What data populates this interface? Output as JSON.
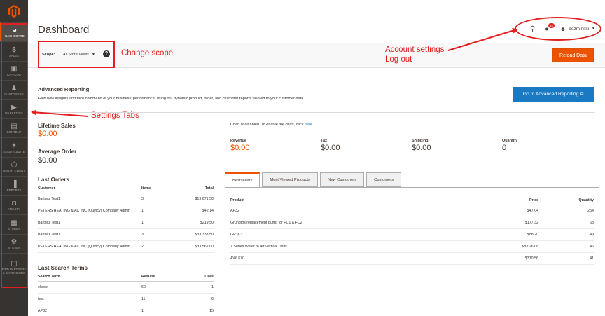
{
  "sidebar": {
    "items": [
      {
        "label": "DASHBOARD",
        "icon": "◕",
        "active": true
      },
      {
        "label": "SALES",
        "icon": "$"
      },
      {
        "label": "CATALOG",
        "icon": "▣"
      },
      {
        "label": "CUSTOMERS",
        "icon": "♟"
      },
      {
        "label": "MARKETING",
        "icon": "▶"
      },
      {
        "label": "CONTENT",
        "icon": "▤"
      },
      {
        "label": "ELASTICSUITE",
        "icon": "✶"
      },
      {
        "label": "OAUTH CLIENT",
        "icon": "⬡"
      },
      {
        "label": "REPORTS",
        "icon": "▐"
      },
      {
        "label": "AMASTY",
        "icon": "◘"
      },
      {
        "label": "STORES",
        "icon": "▦"
      },
      {
        "label": "SYSTEM",
        "icon": "⚙"
      },
      {
        "label": "FIND PARTNERS & EXTENSIONS",
        "icon": "▢"
      }
    ]
  },
  "header": {
    "title": "Dashboard",
    "notification_count": "15",
    "username": "bozminski"
  },
  "scope": {
    "label": "Scope:",
    "value": "All Store Views",
    "help": "?"
  },
  "reload_button": "Reload Data",
  "annotations": {
    "change_scope": "Change scope",
    "account_line1": "Account settings",
    "account_line2": "Log out",
    "settings_tabs": "Settings Tabs"
  },
  "advanced_reporting": {
    "title": "Advanced Reporting",
    "description": "Gain new insights and take command of your business' performance, using our dynamic product, order, and customer reports tailored to your customer data.",
    "button": "Go to Advanced Reporting ⧉"
  },
  "stats": {
    "lifetime_sales_label": "Lifetime Sales",
    "lifetime_sales_value": "$0.00",
    "average_order_label": "Average Order",
    "average_order_value": "$0.00"
  },
  "last_orders": {
    "title": "Last Orders",
    "headers": [
      "Customer",
      "Items",
      "Total"
    ],
    "rows": [
      [
        "Bartosz Test1",
        "3",
        "$19,671.50"
      ],
      [
        "PETERS HEATING & AC INC (Quincy) Company Admin",
        "1",
        "$42.14"
      ],
      [
        "Bartosz Test1",
        "1",
        "$219.50"
      ],
      [
        "Bartosz Test1",
        "3",
        "$33,333.50"
      ],
      [
        "PETERS HEATING & AC INC (Quincy) Company Admin",
        "2",
        "$33,562.00"
      ]
    ]
  },
  "last_search": {
    "title": "Last Search Terms",
    "headers": [
      "Search Term",
      "Results",
      "Uses"
    ],
    "rows": [
      [
        "elbow",
        "60",
        "1"
      ],
      [
        "test",
        "11",
        "6"
      ],
      [
        "AP32",
        "1",
        "15"
      ]
    ]
  },
  "chart_note": {
    "text": "Chart is disabled. To enable the chart, click ",
    "link": "here",
    "suffix": "."
  },
  "metrics": [
    {
      "label": "Revenue",
      "value": "$0.00",
      "highlight": true
    },
    {
      "label": "Tax",
      "value": "$0.00"
    },
    {
      "label": "Shipping",
      "value": "$0.00"
    },
    {
      "label": "Quantity",
      "value": "0"
    }
  ],
  "tabs": [
    "Bestsellers",
    "Most Viewed Products",
    "New Customers",
    "Customers"
  ],
  "bestsellers": {
    "headers": [
      "Product",
      "Price",
      "Quantity"
    ],
    "rows": [
      [
        "AP32",
        "$47.04",
        "254"
      ],
      [
        "Grundfos replacement pump for FC1 & FC2",
        "$177.32",
        "68"
      ],
      [
        "GP3C3",
        "$88.20",
        "49"
      ],
      [
        "7 Series Water to Air Vertical Units",
        "$8,026.08",
        "46"
      ],
      [
        "AWLK01",
        "$310.56",
        "41"
      ]
    ]
  },
  "colors": {
    "sidebar": "#373330",
    "accent": "#eb5202",
    "link": "#1979c3",
    "annotation": "#e31e1e"
  }
}
